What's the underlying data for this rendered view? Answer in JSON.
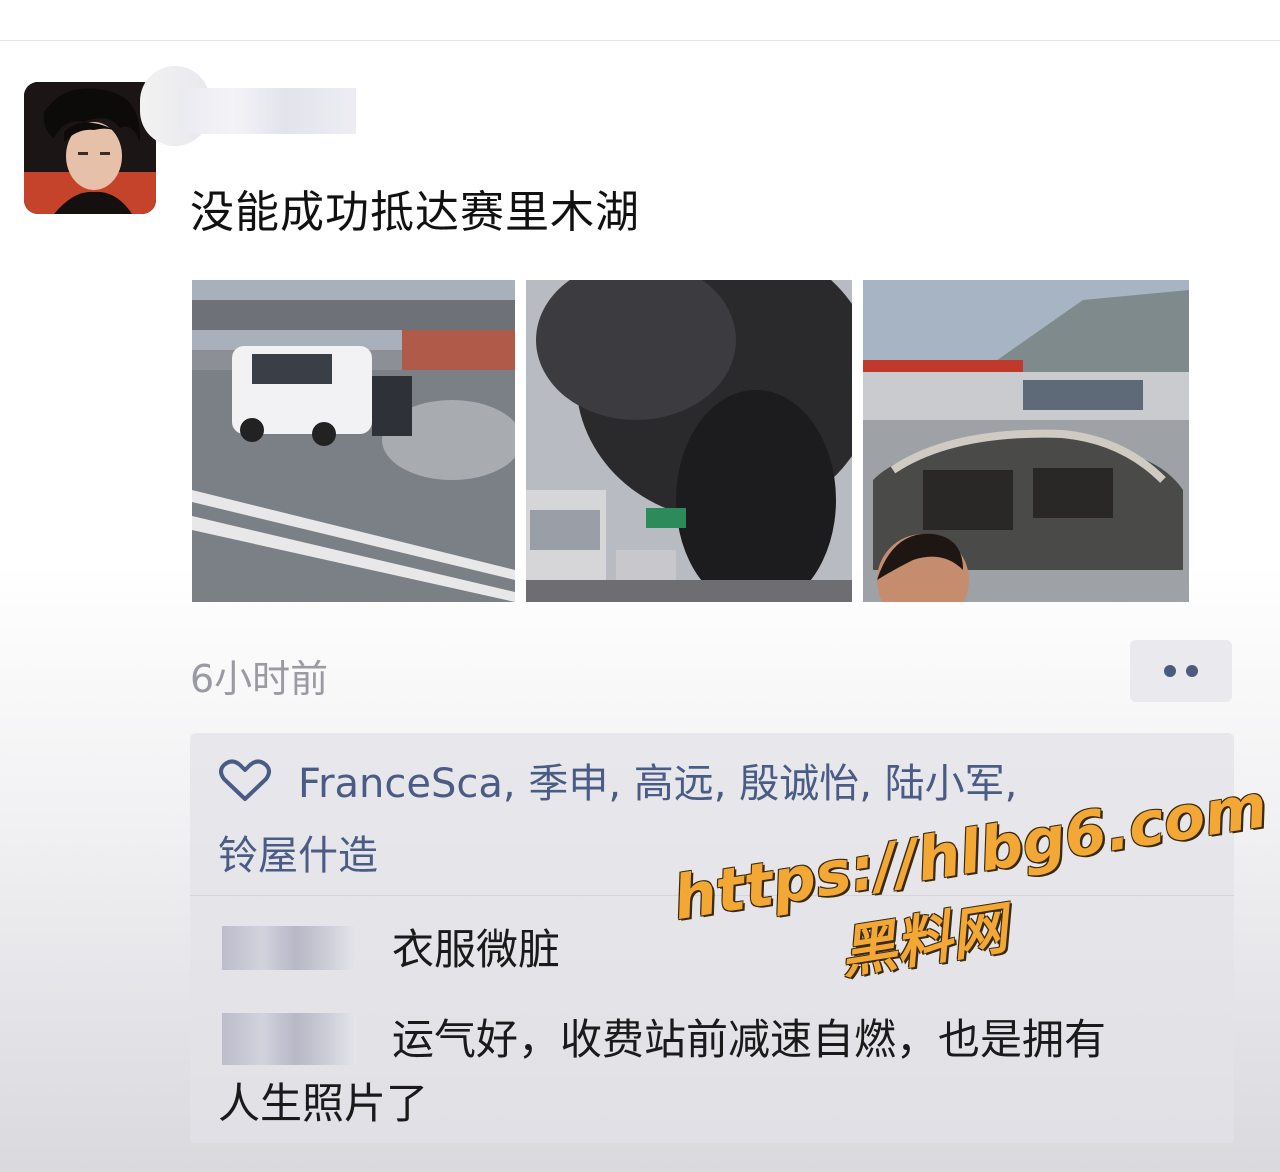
{
  "post": {
    "text": "没能成功抵达赛里木湖",
    "timestamp": "6小时前"
  },
  "photos": [
    {
      "icon": "white-suv-skidding-photo"
    },
    {
      "icon": "black-smoke-fire-photo"
    },
    {
      "icon": "burned-car-wreck-photo"
    }
  ],
  "likes": {
    "line1": "FranceSca, 季申, 高远, 殷诚怡, 陆小军,",
    "line2": "铃屋什造"
  },
  "comments": [
    {
      "text": "衣服微脏"
    },
    {
      "line1": "运气好，收费站前减速自燃，也是拥有",
      "line2": "人生照片了"
    }
  ],
  "watermark": {
    "url": "https://hlbg6.com",
    "site": "黑料网"
  },
  "colors": {
    "accent": "#4a5c86",
    "timestamp": "#9a9aa2",
    "watermark": "#f3a735"
  }
}
